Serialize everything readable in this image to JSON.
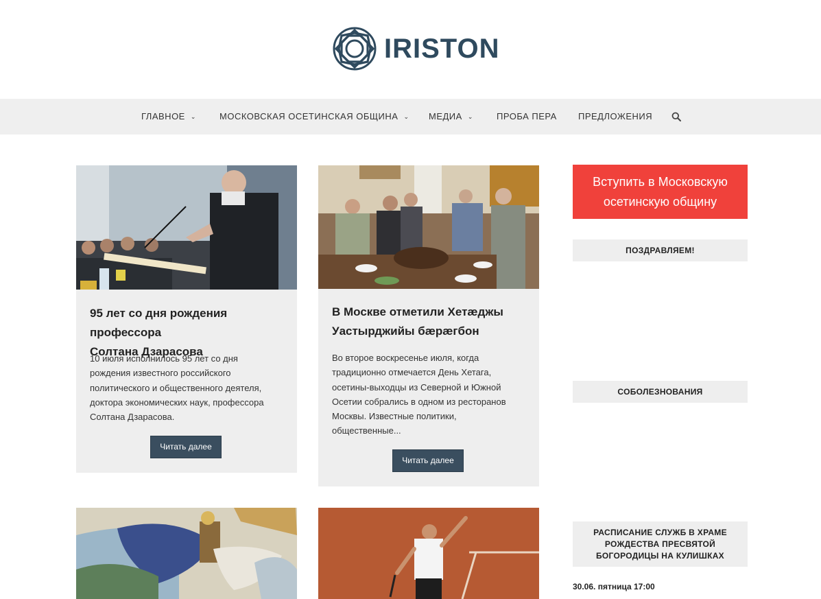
{
  "site": {
    "logo_text": "IRISTON"
  },
  "nav": {
    "items": [
      {
        "label": "ГЛАВНОЕ",
        "has_dropdown": true
      },
      {
        "label": "МОСКОВСКАЯ ОСЕТИНСКАЯ ОБЩИНА",
        "has_dropdown": true
      },
      {
        "label": "МЕДИА",
        "has_dropdown": true
      },
      {
        "label": "ПРОБА ПЕРА",
        "has_dropdown": false
      },
      {
        "label": "ПРЕДЛОЖЕНИЯ",
        "has_dropdown": false
      }
    ],
    "search_icon": "search-icon"
  },
  "posts": [
    {
      "title_line1": "95 лет со дня рождения профессора",
      "title_line2": "Солтана Дзарасова",
      "excerpt": [
        "10 июля исполнилось 95 лет со дня",
        "рождения известного российского",
        "политического и общественного деятеля,",
        "доктора экономических наук, профессора",
        "Солтана Дзарасова."
      ],
      "button": "Читать далее"
    },
    {
      "title_line1": "В Москве отметили Хетæджы",
      "title_line2": "Уастырджийы бæрæгбон",
      "excerpt": [
        "Во второе воскресенье июля, когда",
        "традиционно отмечается День Хетага,",
        "осетины-выходцы из Северной и Южной",
        "Осетии собрались в одном из ресторанов",
        "Москвы. Известные политики,",
        "общественные..."
      ],
      "button": "Читать далее"
    }
  ],
  "sidebar": {
    "cta_line1": "Вступить в Московскую",
    "cta_line2": "осетинскую общину",
    "widgets": [
      {
        "title": "ПОЗДРАВЛЯЕМ!"
      },
      {
        "title": "СОБОЛЕЗНОВАНИЯ"
      },
      {
        "title_line1": "РАСПИСАНИЕ СЛУЖБ В ХРАМЕ",
        "title_line2": "РОЖДЕСТВА ПРЕСВЯТОЙ",
        "title_line3": "БОГОРОДИЦЫ НА КУЛИШКАХ"
      }
    ],
    "schedule_first": "30.06. пятница 17:00"
  },
  "colors": {
    "brand": "#2f4a5e",
    "cta": "#f0413b",
    "button": "#3a4e5f",
    "nav_bg": "#efefef",
    "card_bg": "#eeeeee"
  }
}
